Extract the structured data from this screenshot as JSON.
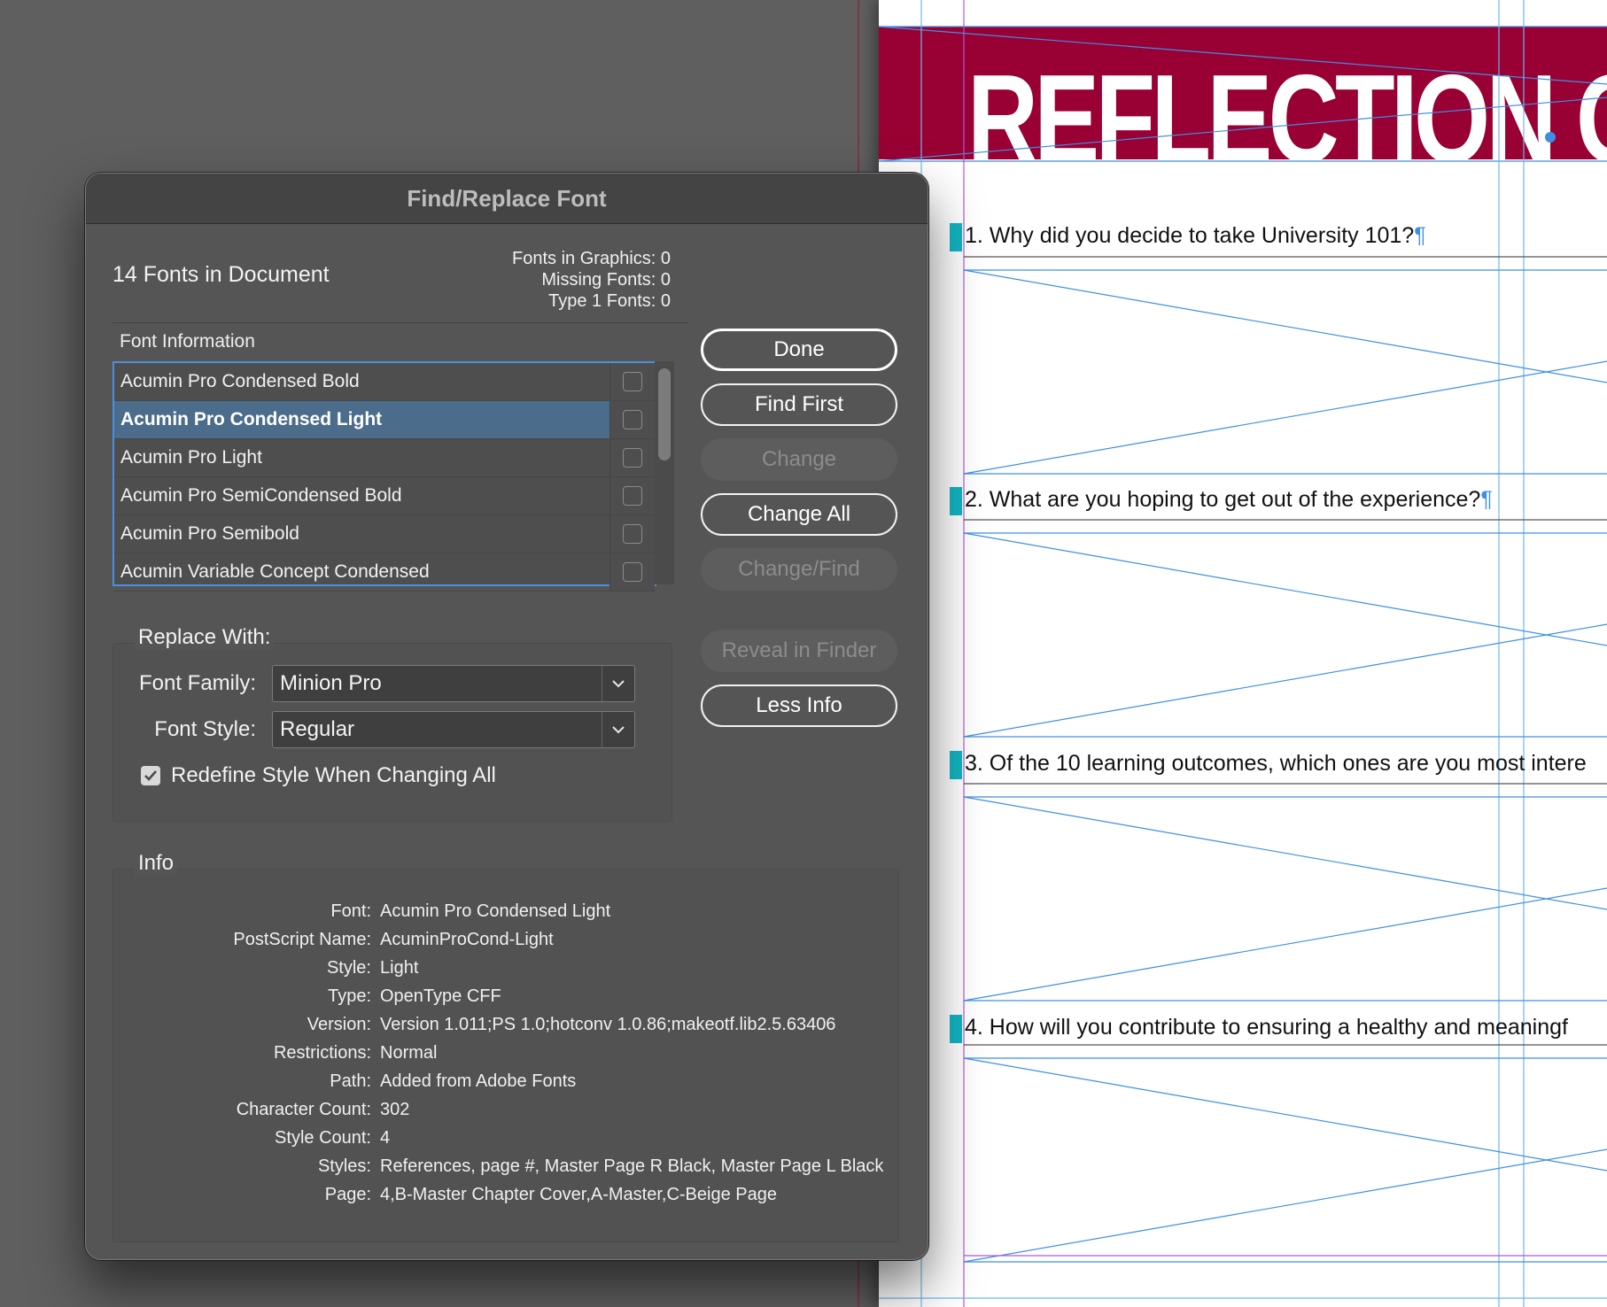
{
  "document": {
    "banner_title": "REFLECTION O",
    "questions": [
      "1. Why did you decide to take University 101?",
      "2. What are you hoping to get out of the experience?",
      "3. Of the 10 learning outcomes, which ones are you most intere",
      "4. How will you contribute to ensuring a healthy and meaningf"
    ],
    "pilcrow": "¶"
  },
  "dialog": {
    "title": "Find/Replace Font",
    "fonts_count": "14 Fonts in Document",
    "stats": {
      "graphics": "Fonts in Graphics: 0",
      "missing": "Missing Fonts: 0",
      "type1": "Type 1 Fonts: 0"
    },
    "font_information_label": "Font Information",
    "font_list": [
      {
        "name": "Acumin Pro Condensed Bold",
        "selected": false
      },
      {
        "name": "Acumin Pro Condensed Light",
        "selected": true
      },
      {
        "name": "Acumin Pro Light",
        "selected": false
      },
      {
        "name": "Acumin Pro SemiCondensed Bold",
        "selected": false
      },
      {
        "name": "Acumin Pro Semibold",
        "selected": false
      },
      {
        "name": "Acumin Variable Concept Condensed",
        "selected": false
      }
    ],
    "buttons": {
      "done": "Done",
      "find_first": "Find First",
      "change": "Change",
      "change_all": "Change All",
      "change_find": "Change/Find",
      "reveal_in_finder": "Reveal in Finder",
      "less_info": "Less Info"
    },
    "replace_with": {
      "label": "Replace With:",
      "font_family_label": "Font Family:",
      "font_family_value": "Minion Pro",
      "font_style_label": "Font Style:",
      "font_style_value": "Regular",
      "redefine_label": "Redefine Style When Changing All",
      "redefine_checked": true
    },
    "info": {
      "label": "Info",
      "rows": [
        {
          "key": "Font:",
          "value": "Acumin Pro Condensed Light"
        },
        {
          "key": "PostScript Name:",
          "value": "AcuminProCond-Light"
        },
        {
          "key": "Style:",
          "value": "Light"
        },
        {
          "key": "Type:",
          "value": "OpenType CFF"
        },
        {
          "key": "Version:",
          "value": "Version 1.011;PS 1.0;hotconv 1.0.86;makeotf.lib2.5.63406"
        },
        {
          "key": "Restrictions:",
          "value": "Normal"
        },
        {
          "key": "Path:",
          "value": "Added from Adobe Fonts"
        },
        {
          "key": "Character Count:",
          "value": "302"
        },
        {
          "key": "Style Count:",
          "value": "4"
        },
        {
          "key": "Styles:",
          "value": "References, page #, Master Page R Black, Master Page L Black"
        },
        {
          "key": "Page:",
          "value": "4,B-Master Chapter Cover,A-Master,C-Beige Page"
        }
      ]
    }
  },
  "colors": {
    "banner": "#990033",
    "selection": "#4c6c8c",
    "focus_ring": "#4a8fe0",
    "guide": "#3d8fe6",
    "question_marker": "#12b5c2"
  }
}
